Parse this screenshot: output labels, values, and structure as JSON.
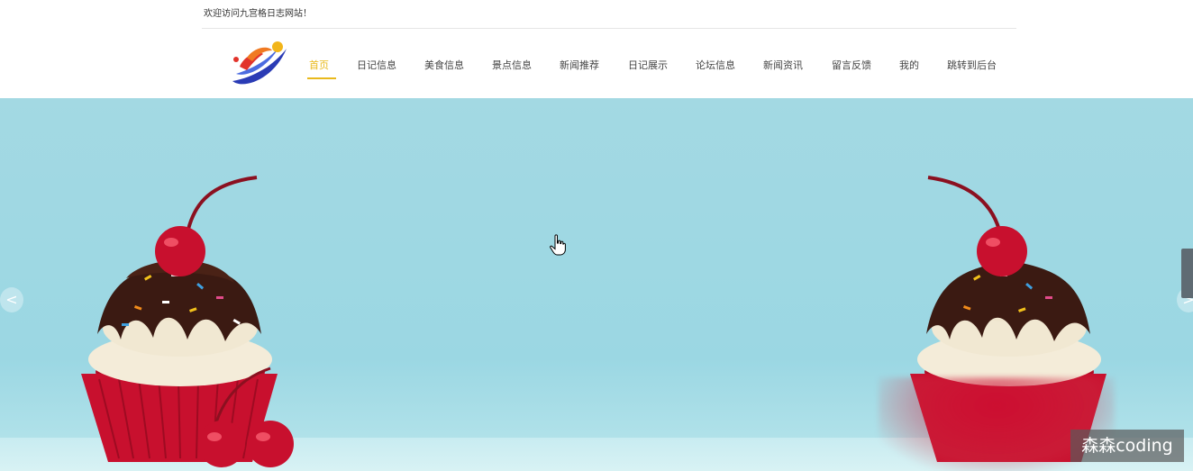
{
  "header": {
    "welcome_text": "欢迎访问九宫格日志网站！"
  },
  "nav": {
    "items": [
      {
        "label": "首页",
        "active": true
      },
      {
        "label": "日记信息"
      },
      {
        "label": "美食信息"
      },
      {
        "label": "景点信息"
      },
      {
        "label": "新闻推荐"
      },
      {
        "label": "日记展示"
      },
      {
        "label": "论坛信息"
      },
      {
        "label": "新闻资讯"
      },
      {
        "label": "留言反馈"
      },
      {
        "label": "我的"
      },
      {
        "label": "跳转到后台"
      }
    ]
  },
  "banner": {
    "prev_label": "<",
    "next_label": ">",
    "image": "cupcake-with-cherries"
  },
  "watermark": {
    "text": "森森coding"
  },
  "colors": {
    "accent": "#e9b91c",
    "banner_bg": "#9bd7e3",
    "cupcake_red": "#c8102e"
  }
}
